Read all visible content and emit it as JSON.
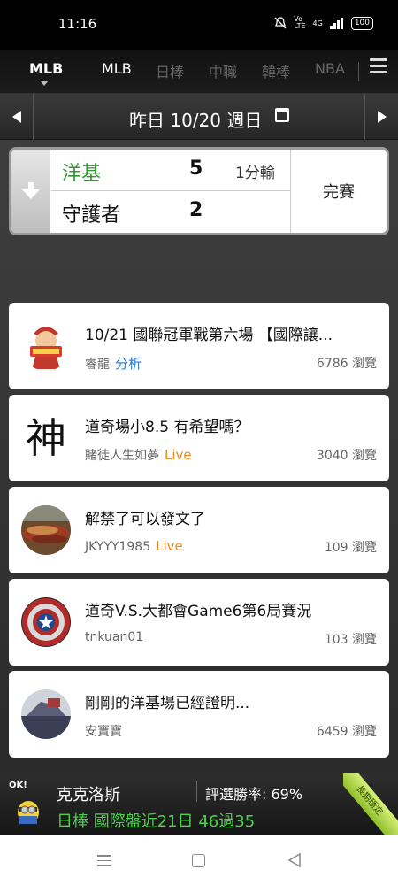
{
  "status_bar": {
    "time": "11:16",
    "icons": [
      "mute-icon",
      "volte-icon",
      "signal-icon"
    ],
    "network": "4G",
    "battery": "100"
  },
  "league_tabs": {
    "items": [
      {
        "label": "MLB",
        "active": true
      },
      {
        "label": "MLB",
        "active": false
      },
      {
        "label": "日棒",
        "active": false
      },
      {
        "label": "中職",
        "active": false
      },
      {
        "label": "韓棒",
        "active": false
      },
      {
        "label": "NBA",
        "active": false
      }
    ]
  },
  "date_bar": {
    "label": "昨日 10/20 週日"
  },
  "game": {
    "team1": {
      "name": "洋基",
      "score": "5",
      "note": "1分輸",
      "color": "#2f9a2f"
    },
    "team2": {
      "name": "守護者",
      "score": "2",
      "note": ""
    },
    "status": "完賽"
  },
  "posts": [
    {
      "title": "10/21 國聯冠軍戰第六場 【國際讓...",
      "author": "睿龍",
      "tag": "分析",
      "tag_type": "analysis",
      "views": "6786 瀏覽",
      "avatar": "badge-avatar"
    },
    {
      "title": "道奇場小8.5 有希望嗎？",
      "author": "賭徒人生如夢",
      "tag": "Live",
      "tag_type": "live",
      "views": "3040 瀏覽",
      "avatar": "god-character-avatar",
      "avatar_char": "神"
    },
    {
      "title": "解禁了可以發文了",
      "author": "JKYYY1985",
      "tag": "Live",
      "tag_type": "live",
      "views": "109 瀏覽",
      "avatar": "food-photo-avatar"
    },
    {
      "title": "道奇V.S.大都會Game6第6局賽況",
      "author": "tnkuan01",
      "tag": "",
      "tag_type": "",
      "views": "103 瀏覽",
      "avatar": "shield-avatar"
    },
    {
      "title": "剛剛的洋基場已經證明...",
      "author": "安寶寶",
      "tag": "",
      "tag_type": "",
      "views": "6459 瀏覽",
      "avatar": "photo-avatar"
    }
  ],
  "expert": {
    "name": "克克洛斯",
    "rate": "評選勝率: 69%",
    "record": "日棒 國際盤近21日 46過35",
    "ribbon": "長期穩定",
    "avatar_text": "OK!"
  },
  "colors": {
    "accent_green": "#2f9a2f",
    "live_orange": "#f08a1c",
    "analysis_blue": "#2b7bd3",
    "record_green": "#4fd04f"
  }
}
